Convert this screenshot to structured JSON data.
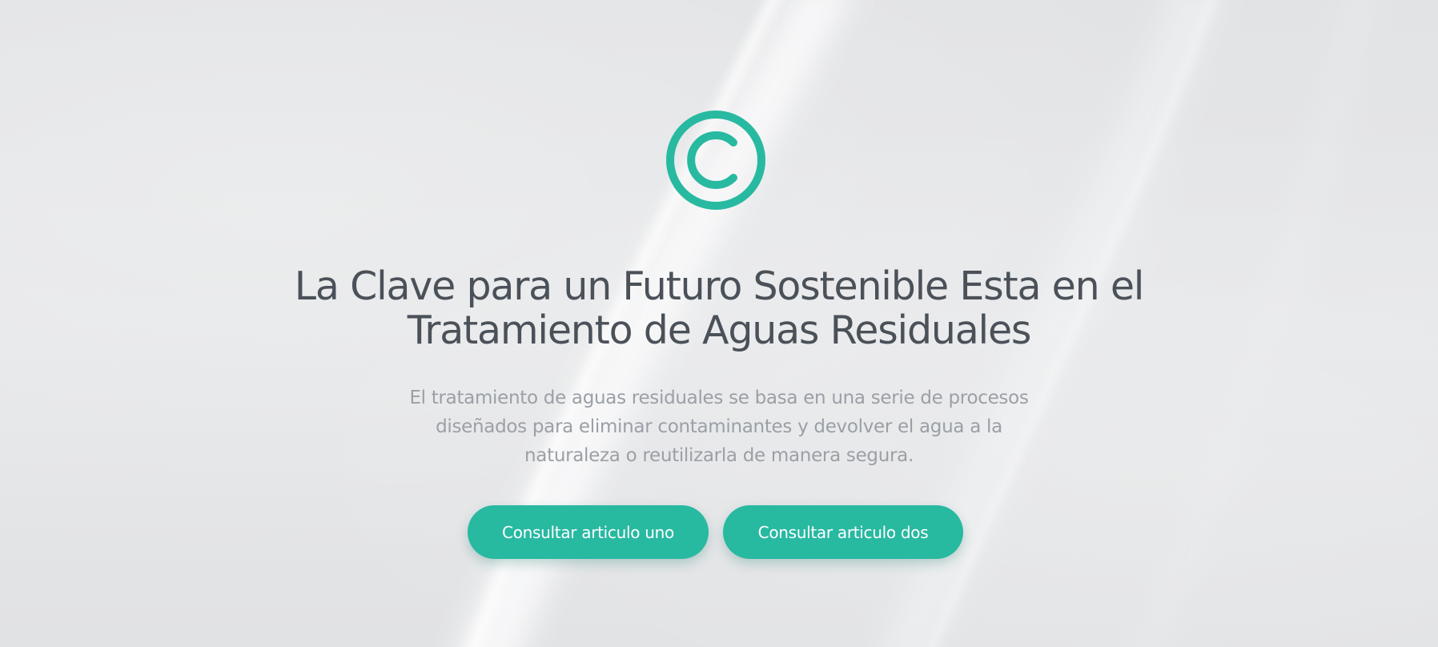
{
  "hero": {
    "title_line1": "La Clave para un Futuro Sostenible Esta en el",
    "title_line2": "Tratamiento de Aguas Residuales",
    "subtitle_line1": "El tratamiento de aguas residuales se basa en una serie de procesos",
    "subtitle_line2": "diseñados para eliminar contaminantes y devolver el agua a la",
    "subtitle_line3": "naturaleza o reutilizarla de manera segura.",
    "logo_icon": "copyright-c-icon"
  },
  "buttons": {
    "primary_label": "Consultar articulo uno",
    "secondary_label": "Consultar articulo dos"
  },
  "colors": {
    "accent": "#28b9a1",
    "title": "#4b5159",
    "subtitle": "#9aa0a6",
    "background": "#e3e4e6"
  }
}
